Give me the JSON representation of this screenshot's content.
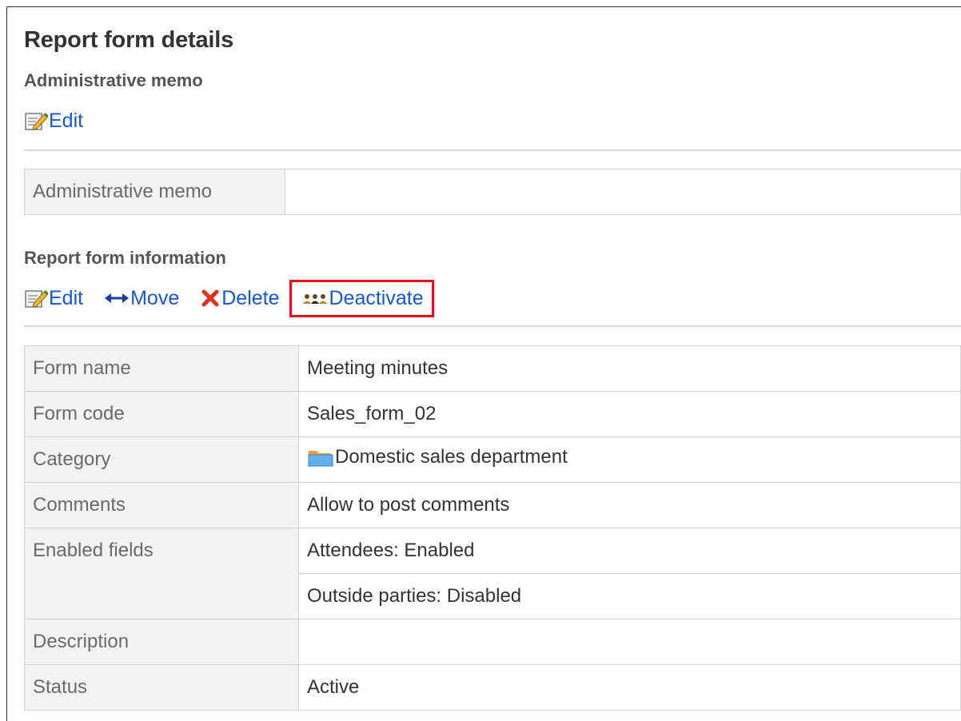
{
  "page_title": "Report form details",
  "memo_section": {
    "title": "Administrative memo",
    "edit_label": "Edit",
    "row_label": "Administrative memo",
    "row_value": ""
  },
  "info_section": {
    "title": "Report form information",
    "actions": {
      "edit": "Edit",
      "move": "Move",
      "delete": "Delete",
      "deactivate": "Deactivate"
    },
    "rows": {
      "form_name": {
        "label": "Form name",
        "value": "Meeting minutes"
      },
      "form_code": {
        "label": "Form code",
        "value": "Sales_form_02"
      },
      "category": {
        "label": "Category",
        "value": "Domestic sales department"
      },
      "comments": {
        "label": "Comments",
        "value": "Allow to post comments"
      },
      "enabled_fields": {
        "label": "Enabled fields",
        "values": [
          "Attendees: Enabled",
          "Outside parties: Disabled"
        ]
      },
      "description": {
        "label": "Description",
        "value": ""
      },
      "status": {
        "label": "Status",
        "value": "Active"
      }
    }
  },
  "colors": {
    "link": "#1558d6",
    "highlight_border": "#e3131b",
    "status_active": "#2e9a28",
    "label_bg": "#f2f2f2"
  },
  "icons": {
    "edit": "edit-pencil-icon",
    "move": "left-right-arrow-icon",
    "delete": "red-x-icon",
    "deactivate": "users-inactive-icon",
    "category": "folder-icon"
  }
}
